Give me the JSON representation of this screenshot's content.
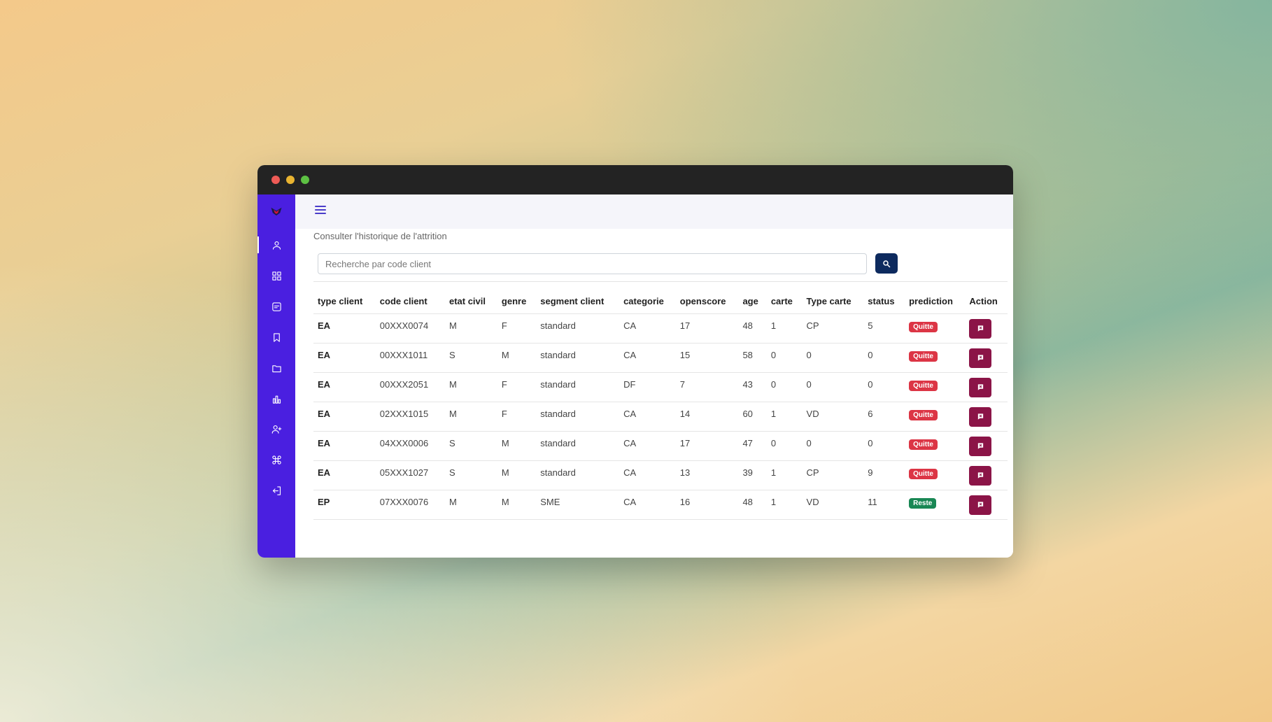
{
  "page": {
    "title": "Consulter l'historique de l'attrition"
  },
  "search": {
    "placeholder": "Recherche par code client"
  },
  "colors": {
    "sidebar": "#4a1fe0",
    "search_button": "#0d2a5e",
    "action_button": "#8b1447",
    "badge_quitte": "#dc3545",
    "badge_reste": "#198754"
  },
  "sidebar": {
    "items": [
      {
        "icon": "user-icon"
      },
      {
        "icon": "grid-icon"
      },
      {
        "icon": "message-icon"
      },
      {
        "icon": "bookmark-icon"
      },
      {
        "icon": "folder-icon"
      },
      {
        "icon": "bar-chart-icon"
      },
      {
        "icon": "user-plus-icon"
      },
      {
        "icon": "command-icon"
      },
      {
        "icon": "logout-icon"
      }
    ]
  },
  "table": {
    "headers": [
      "type client",
      "code client",
      "etat civil",
      "genre",
      "segment client",
      "categorie",
      "openscore",
      "age",
      "carte",
      "Type carte",
      "status",
      "prediction",
      "Action"
    ],
    "rows": [
      [
        "EA",
        "00XXX0074",
        "M",
        "F",
        "standard",
        "CA",
        "17",
        "48",
        "1",
        "CP",
        "5",
        "Quitte"
      ],
      [
        "EA",
        "00XXX1011",
        "S",
        "M",
        "standard",
        "CA",
        "15",
        "58",
        "0",
        "0",
        "0",
        "Quitte"
      ],
      [
        "EA",
        "00XXX2051",
        "M",
        "F",
        "standard",
        "DF",
        "7",
        "43",
        "0",
        "0",
        "0",
        "Quitte"
      ],
      [
        "EA",
        "02XXX1015",
        "M",
        "F",
        "standard",
        "CA",
        "14",
        "60",
        "1",
        "VD",
        "6",
        "Quitte"
      ],
      [
        "EA",
        "04XXX0006",
        "S",
        "M",
        "standard",
        "CA",
        "17",
        "47",
        "0",
        "0",
        "0",
        "Quitte"
      ],
      [
        "EA",
        "05XXX1027",
        "S",
        "M",
        "standard",
        "CA",
        "13",
        "39",
        "1",
        "CP",
        "9",
        "Quitte"
      ],
      [
        "EP",
        "07XXX0076",
        "M",
        "M",
        "SME",
        "CA",
        "16",
        "48",
        "1",
        "VD",
        "11",
        "Reste"
      ]
    ]
  }
}
